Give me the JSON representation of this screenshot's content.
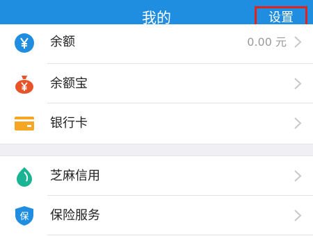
{
  "header": {
    "title": "我的",
    "settings_label": "设置"
  },
  "menu": [
    {
      "label": "余额",
      "value": "0.00 元",
      "icon": "yen-circle-icon"
    },
    {
      "label": "余额宝",
      "value": "",
      "icon": "money-bag-icon"
    },
    {
      "label": "银行卡",
      "value": "",
      "icon": "bank-card-icon"
    },
    {
      "label": "芝麻信用",
      "value": "",
      "icon": "sesame-credit-icon"
    },
    {
      "label": "保险服务",
      "value": "",
      "icon": "insurance-shield-icon"
    }
  ],
  "colors": {
    "header": "#1f8ee0",
    "highlight": "#e2231a",
    "balance_icon": "#1f8ee0",
    "yuebao_icon": "#e8542a",
    "card_icon": "#f5a623",
    "sesame_icon": "#1ab394",
    "insurance_icon": "#1f8ee0"
  }
}
